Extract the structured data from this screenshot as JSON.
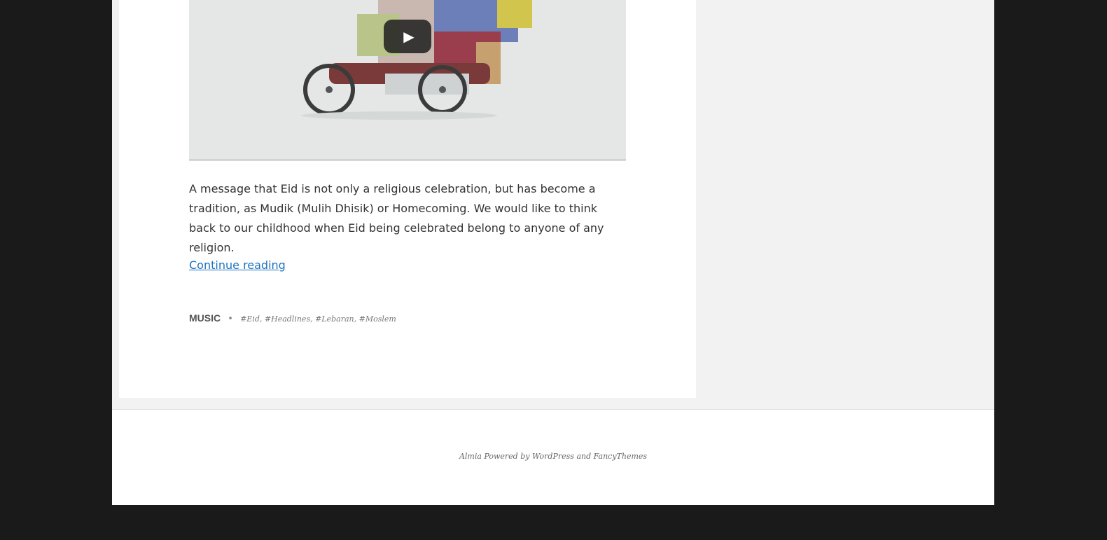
{
  "post": {
    "video": {
      "play_icon": "▶"
    },
    "excerpt": "A message that Eid is not only a religious celebration, but has become a tradition, as Mudik (Mulih Dhisik) or Homecoming. We would like to think back to our childhood when Eid being celebrated belong to anyone of any religion.",
    "continue_label": "Continue reading",
    "category": "MUSIC",
    "separator": "•",
    "tags": [
      "#Eid",
      "#Headlines",
      "#Lebaran",
      "#Moslem"
    ]
  },
  "footer": {
    "site_name": "Almia",
    "powered_text": "Powered by",
    "wordpress": "WordPress",
    "and_text": "and",
    "theme": "FancyThemes"
  },
  "colors": {
    "background": "#1a1a1a",
    "link": "#1e73be",
    "sidebar": "#f2f2f2"
  }
}
